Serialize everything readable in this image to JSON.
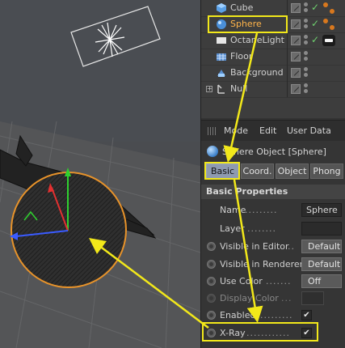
{
  "objects": [
    {
      "label": "Cube",
      "icon": "cube-icon",
      "selected": false
    },
    {
      "label": "Sphere",
      "icon": "sphere-icon",
      "selected": true
    },
    {
      "label": "OctaneLight",
      "icon": "octane-light-icon",
      "selected": false
    },
    {
      "label": "Floor",
      "icon": "floor-icon",
      "selected": false
    },
    {
      "label": "Background",
      "icon": "background-icon",
      "selected": false
    },
    {
      "label": "Null",
      "icon": "null-icon",
      "selected": false
    }
  ],
  "attribute_manager": {
    "menu": [
      "Mode",
      "Edit",
      "User Data"
    ],
    "title": "Sphere Object [Sphere]",
    "tabs": [
      "Basic",
      "Coord.",
      "Object",
      "Phong"
    ],
    "active_tab": "Basic",
    "section": "Basic Properties",
    "properties": [
      {
        "label": "Name",
        "dots": ".........",
        "value": "Sphere",
        "kind": "text"
      },
      {
        "label": "Layer",
        "dots": "........",
        "value": "",
        "kind": "text"
      },
      {
        "label": "Visible in Editor",
        "dots": "..",
        "value": "Default",
        "kind": "dropdown"
      },
      {
        "label": "Visible in Renderer",
        "dots": "",
        "value": "Default",
        "kind": "dropdown"
      },
      {
        "label": "Use Color",
        "dots": ".......",
        "value": "Off",
        "kind": "dropdown"
      },
      {
        "label": "Display Color",
        "dots": "...",
        "value": "",
        "kind": "color"
      },
      {
        "label": "Enabled",
        "dots": "...........",
        "value": "✔",
        "kind": "checkbox"
      },
      {
        "label": "X-Ray",
        "dots": "............",
        "value": "✔",
        "kind": "checkbox"
      }
    ]
  },
  "colors": {
    "annotation": "#f2e81a",
    "selection_outline": "#e8932a",
    "axis_x": "#e33030",
    "axis_y": "#2fd12f",
    "axis_z": "#3a5bff"
  }
}
